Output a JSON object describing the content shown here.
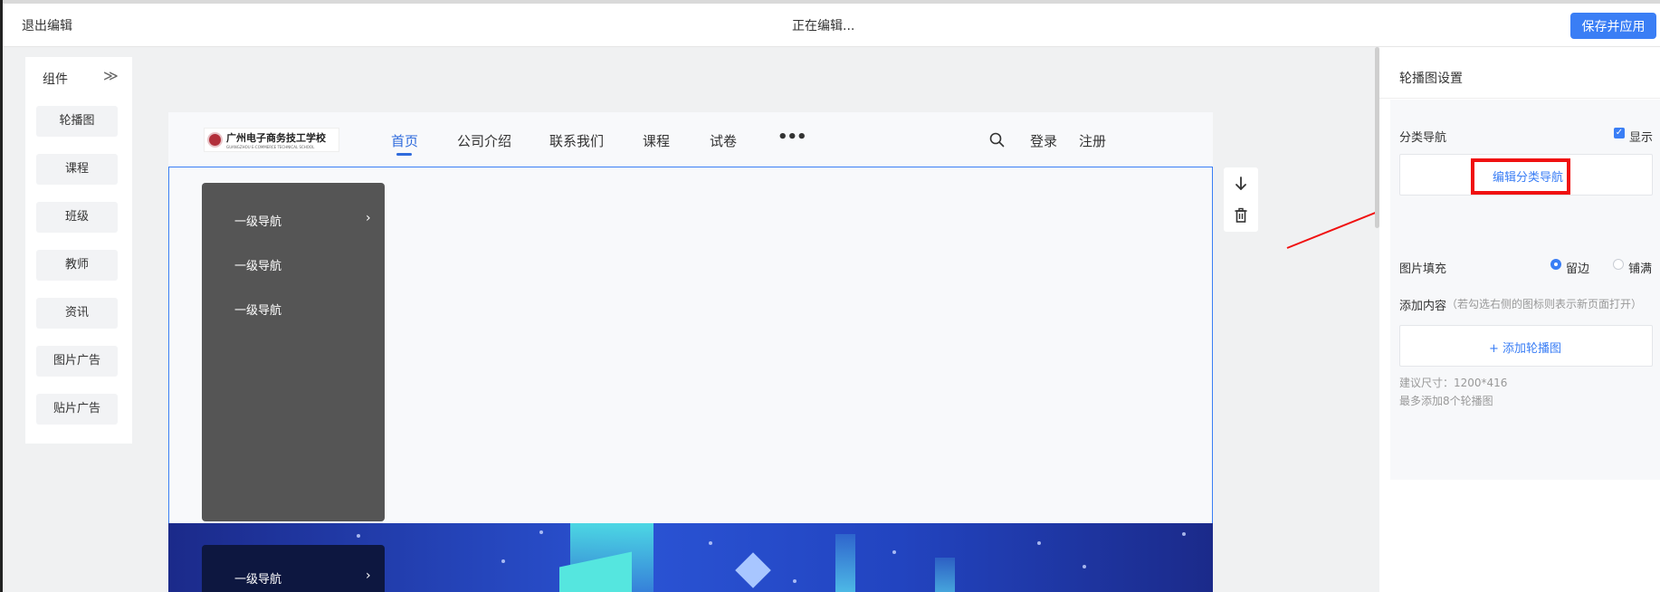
{
  "topbar": {
    "exit_label": "退出编辑",
    "status_text": "正在编辑...",
    "save_label": "保存并应用"
  },
  "palette": {
    "title": "组件",
    "collapse_icon": "double-chevron-right-icon",
    "items": [
      "轮播图",
      "课程",
      "班级",
      "教师",
      "资讯",
      "图片广告",
      "贴片广告"
    ]
  },
  "preview": {
    "logo": {
      "cn": "广州电子商务技工学校",
      "en": "GUANGZHOU E-COMMERCE TECHNICAL SCHOOL"
    },
    "nav": {
      "items": [
        "首页",
        "公司介绍",
        "联系我们",
        "课程",
        "试卷"
      ],
      "active_index": 0,
      "more": "•••",
      "login": "登录",
      "register": "注册"
    },
    "category_nav": {
      "items": [
        "一级导航",
        "一级导航",
        "一级导航"
      ],
      "second_banner_item": "一级导航"
    }
  },
  "side_tools": {
    "move_down_icon": "arrow-down-icon",
    "delete_icon": "trash-icon"
  },
  "settings": {
    "title": "轮播图设置",
    "category_nav_label": "分类导航",
    "show_label": "显示",
    "show_checked": true,
    "edit_category_nav": "编辑分类导航",
    "image_fill_label": "图片填充",
    "fill_options": [
      "留边",
      "铺满"
    ],
    "fill_selected": 0,
    "add_content_label": "添加内容",
    "add_content_hint": "（若勾选右侧的图标则表示新页面打开）",
    "add_banner": "+ 添加轮播图",
    "size_hint": "建议尺寸：1200*416",
    "max_hint": "最多添加8个轮播图"
  },
  "colors": {
    "accent": "#3a7ef5",
    "highlight": "#f01010",
    "category_nav_bg": "#555555"
  }
}
